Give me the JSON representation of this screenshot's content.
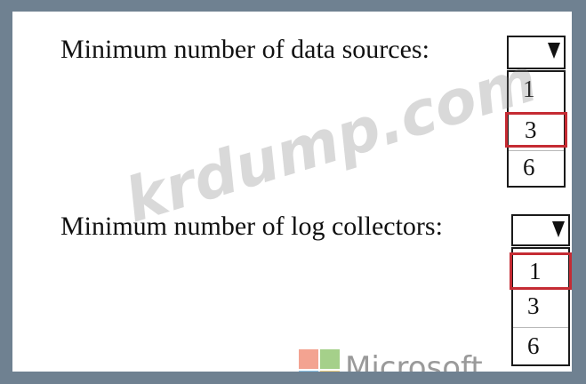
{
  "questions": [
    {
      "label": "Minimum number of data sources:",
      "options": [
        "1",
        "3",
        "6"
      ],
      "selected": "3"
    },
    {
      "label": "Minimum number of log collectors:",
      "options": [
        "1",
        "3",
        "6"
      ],
      "selected": "1"
    }
  ],
  "watermark": "krdump.com",
  "branding": {
    "name": "Microsoft"
  },
  "colors": {
    "frame": "#6f8191",
    "panel": "#ffffff",
    "selection_border": "#c52b33"
  }
}
